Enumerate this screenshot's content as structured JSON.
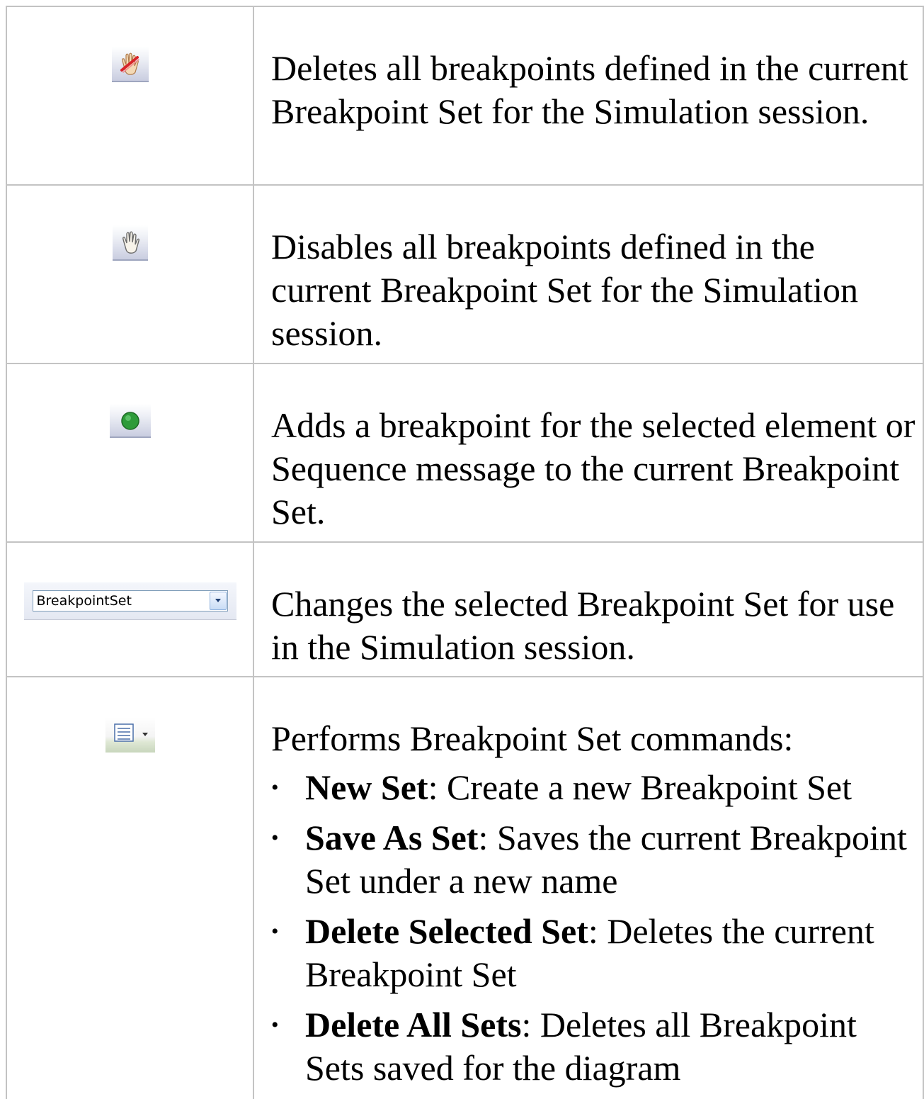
{
  "rows": [
    {
      "icon": "delete-breakpoints-icon",
      "description": "Deletes all breakpoints defined in the current Breakpoint Set for the Simulation session."
    },
    {
      "icon": "disable-breakpoints-icon",
      "description": "Disables all breakpoints defined in the current Breakpoint Set for the Simulation session."
    },
    {
      "icon": "add-breakpoint-icon",
      "description": "Adds a breakpoint for the selected element or Sequence message to the current Breakpoint Set."
    },
    {
      "icon": "breakpoint-set-combo",
      "combo_value": "BreakpointSet",
      "description": "Changes the selected Breakpoint Set for use in the Simulation session."
    },
    {
      "icon": "breakpoint-set-menu-icon",
      "description": "Performs Breakpoint Set commands:",
      "bullet": "•",
      "items": [
        {
          "term": "New Set",
          "text": ": Create a new Breakpoint Set"
        },
        {
          "term": "Save As Set",
          "text": ": Saves the current Breakpoint Set under a new name"
        },
        {
          "term": "Delete Selected Set",
          "text": ": Deletes the current Breakpoint Set"
        },
        {
          "term": "Delete All Sets",
          "text": ": Deletes all Breakpoint Sets saved for the diagram"
        }
      ]
    }
  ],
  "colors": {
    "border": "#c3c3c3",
    "add_breakpoint_green": "#2e9b3a",
    "combo_border": "#7f9db9"
  }
}
